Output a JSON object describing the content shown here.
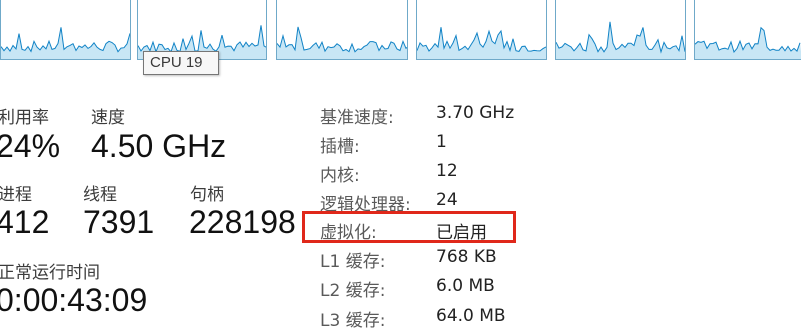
{
  "tooltip": "CPU 19",
  "accent": "#1183c6",
  "graph_fill": "#c8e6f5",
  "stats": {
    "utilization_label": "利用率",
    "utilization_value": "24%",
    "speed_label": "速度",
    "speed_value": "4.50 GHz",
    "processes_label": "进程",
    "processes_value": "412",
    "threads_label": "线程",
    "threads_value": "7391",
    "handles_label": "句柄",
    "handles_value": "228198",
    "uptime_label": "正常运行时间",
    "uptime_value": "0:00:43:09"
  },
  "specs": [
    {
      "key": "基准速度:",
      "value": "3.70 GHz"
    },
    {
      "key": "插槽:",
      "value": "1"
    },
    {
      "key": "内核:",
      "value": "12"
    },
    {
      "key": "逻辑处理器:",
      "value": "24"
    },
    {
      "key": "虚拟化:",
      "value": "已启用"
    },
    {
      "key": "L1 缓存:",
      "value": "768 KB"
    },
    {
      "key": "L2 缓存:",
      "value": "6.0 MB"
    },
    {
      "key": "L3 缓存:",
      "value": "64.0 MB"
    }
  ]
}
